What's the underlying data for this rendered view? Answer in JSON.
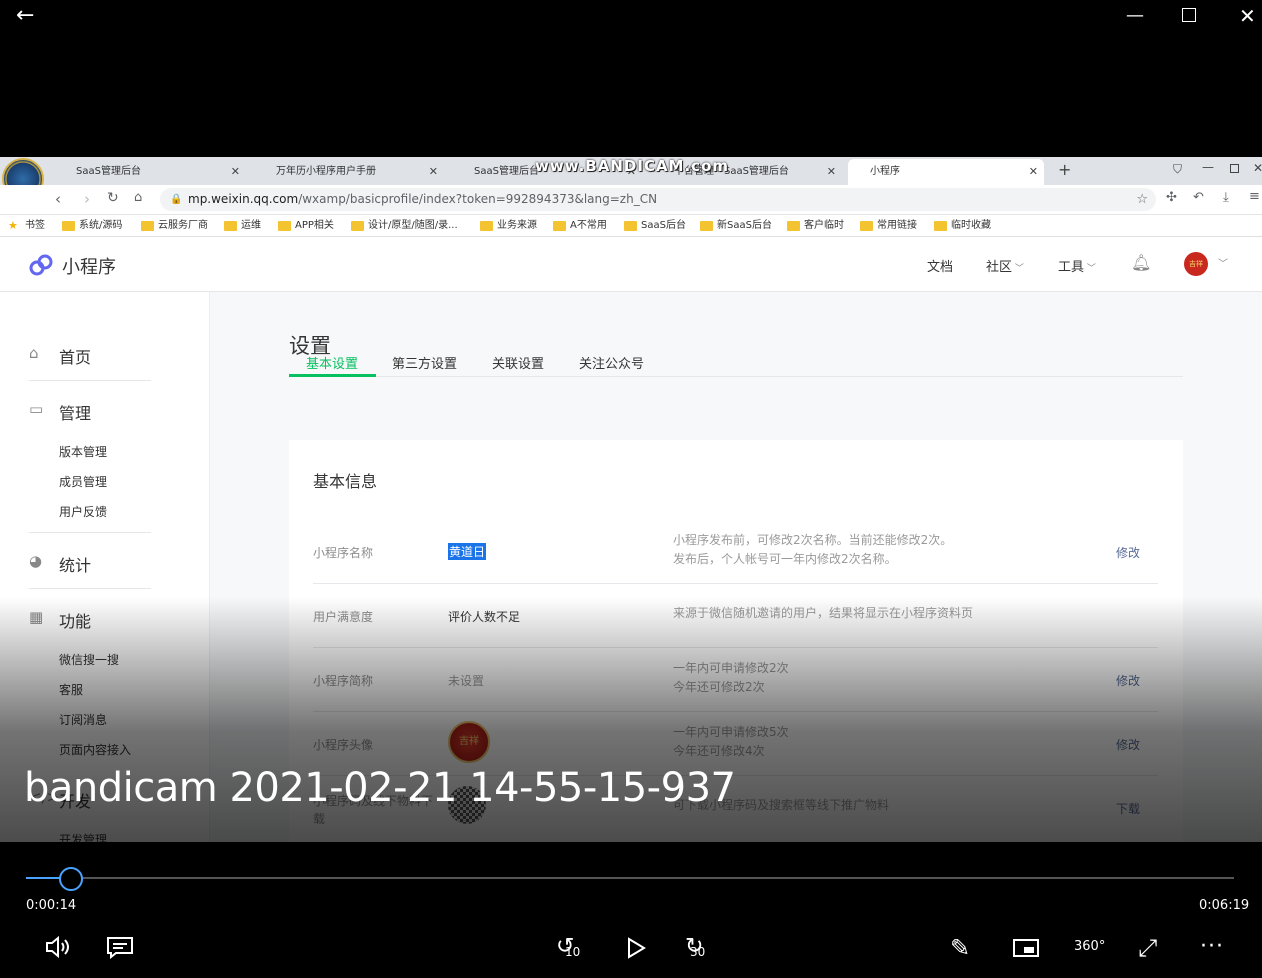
{
  "player": {
    "back_icon": "back-arrow-icon",
    "minimize_icon": "minimize-icon",
    "maximize_icon": "maximize-icon",
    "close_icon": "close-icon",
    "video_title": "bandicam 2021-02-21 14-55-15-937",
    "current_time": "0:00:14",
    "total_time": "0:06:19",
    "progress": 0.037,
    "skip_back": "10",
    "skip_forward": "30",
    "vr_label": "360°"
  },
  "browser": {
    "watermark": "www.BANDICAM.com",
    "tabs": [
      {
        "label": "SaaS管理后台"
      },
      {
        "label": "万年历小程序用户手册"
      },
      {
        "label": "SaaS管理后台"
      },
      {
        "label": "平台管理 - SaaS管理后台"
      },
      {
        "label": "小程序"
      }
    ],
    "url_domain": "mp.weixin.qq.com",
    "url_path": "/wxamp/basicprofile/index?token=992894373&lang=zh_CN",
    "bookmarks": [
      "书签",
      "系统/源码",
      "云服务厂商",
      "运维",
      "APP相关",
      "设计/原型/随图/录...",
      "业务来源",
      "A不常用",
      "SaaS后台",
      "新SaaS后台",
      "客户临时",
      "常用链接",
      "临时收藏"
    ]
  },
  "app": {
    "logo_text": "小程序",
    "nav": {
      "docs": "文档",
      "community": "社区",
      "tools": "工具"
    },
    "avatar_text": "吉祥"
  },
  "sidebar": {
    "home": "首页",
    "manage": "管理",
    "manage_items": [
      "版本管理",
      "成员管理",
      "用户反馈"
    ],
    "stats": "统计",
    "features": "功能",
    "feature_items": [
      "微信搜一搜",
      "客服",
      "订阅消息",
      "页面内容接入"
    ],
    "dev": "开发",
    "dev_items": [
      "开发管理"
    ]
  },
  "page": {
    "title": "设置",
    "tabs": [
      "基本设置",
      "第三方设置",
      "关联设置",
      "关注公众号"
    ],
    "section_title": "基本信息",
    "rows": [
      {
        "label": "小程序名称",
        "value": "黄道日",
        "tip1": "小程序发布前，可修改2次名称。当前还能修改2次。",
        "tip2": "发布后，个人帐号可一年内修改2次名称。",
        "action": "修改"
      },
      {
        "label": "用户满意度",
        "value": "评价人数不足",
        "tip1": "来源于微信随机邀请的用户，结果将显示在小程序资料页",
        "tip2": "",
        "action": ""
      },
      {
        "label": "小程序简称",
        "value": "未设置",
        "tip1": "一年内可申请修改2次",
        "tip2": "今年还可修改2次",
        "action": "修改"
      },
      {
        "label": "小程序头像",
        "value": "",
        "tip1": "一年内可申请修改5次",
        "tip2": "今年还可修改4次",
        "action": "修改"
      },
      {
        "label": "小程序码及线下物料下载",
        "value": "",
        "tip1": "可下载小程序码及搜索框等线下推广物料",
        "tip2": "",
        "action": "下载"
      }
    ]
  }
}
